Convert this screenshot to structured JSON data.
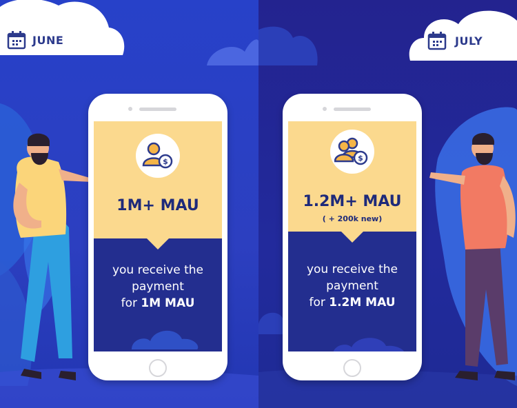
{
  "left": {
    "month": "JUNE",
    "calendar_icon": "calendar-icon",
    "mau_headline": "1M+ MAU",
    "desc_line1": "you receive the",
    "desc_line2": "payment",
    "desc_prefix": "for ",
    "desc_bold": "1M MAU"
  },
  "right": {
    "month": "JULY",
    "calendar_icon": "calendar-icon",
    "mau_headline": "1.2M+ MAU",
    "mau_sub": "( + 200k new)",
    "desc_line1": "you receive the",
    "desc_line2": "payment",
    "desc_prefix": "for ",
    "desc_bold": "1.2M MAU"
  },
  "colors": {
    "left_bg": "#2741c9",
    "right_bg": "#23238f",
    "screen_top": "#fbd98e",
    "screen_bottom": "#232e8f",
    "text_dark": "#1e2a7a"
  }
}
